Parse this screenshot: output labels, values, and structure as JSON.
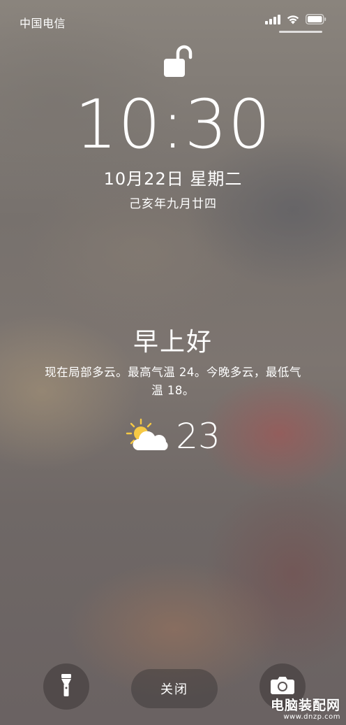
{
  "status_bar": {
    "carrier": "中国电信"
  },
  "lock_screen": {
    "time": "10:30",
    "date": "10月22日 星期二",
    "lunar_date": "己亥年九月廿四"
  },
  "widget": {
    "greeting": "早上好",
    "forecast": "现在局部多云。最高气温 24。今晚多云，最低气温 18。",
    "temperature": "23",
    "icon": "partly-cloudy-icon"
  },
  "controls": {
    "flashlight_icon": "flashlight-icon",
    "close_label": "关闭",
    "camera_icon": "camera-icon"
  },
  "watermark": {
    "title": "电脑装配网",
    "url": "www.dnzp.com"
  }
}
